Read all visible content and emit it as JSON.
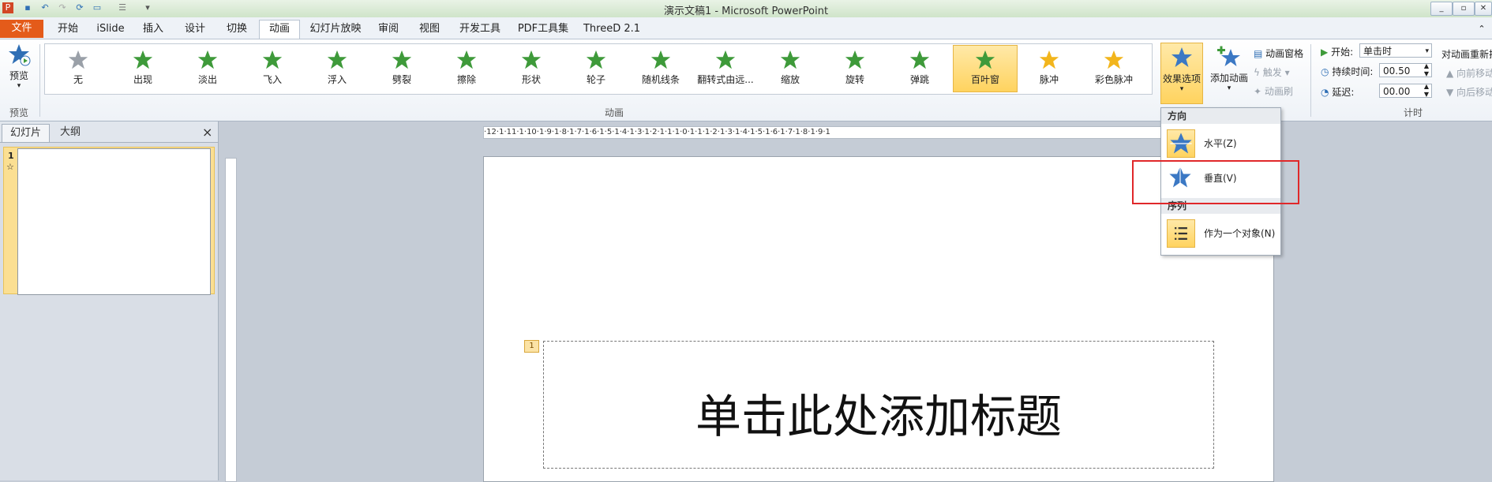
{
  "window": {
    "title": "演示文稿1 - Microsoft PowerPoint"
  },
  "tabs": [
    "文件",
    "开始",
    "iSlide",
    "插入",
    "设计",
    "切换",
    "动画",
    "幻灯片放映",
    "审阅",
    "视图",
    "开发工具",
    "PDF工具集",
    "ThreeD 2.1"
  ],
  "ribbon": {
    "preview_label": "预览",
    "preview_group": "预览",
    "animation_group": "动画",
    "timing_group": "计时",
    "animations": [
      "无",
      "出现",
      "淡出",
      "飞入",
      "浮入",
      "劈裂",
      "擦除",
      "形状",
      "轮子",
      "随机线条",
      "翻转式由远...",
      "缩放",
      "旋转",
      "弹跳",
      "百叶窗",
      "脉冲",
      "彩色脉冲"
    ],
    "selected_animation": "百叶窗",
    "effect_options": "效果选项",
    "add_animation": "添加动画",
    "animation_pane": "动画窗格",
    "trigger": "触发",
    "animation_painter": "动画刷",
    "start_label": "开始:",
    "start_value": "单击时",
    "duration_label": "持续时间:",
    "duration_value": "00.50",
    "delay_label": "延迟:",
    "delay_value": "00.00",
    "reorder_label": "对动画重新排",
    "move_earlier": "向前移动",
    "move_later": "向后移动"
  },
  "left_pane": {
    "tab_slides": "幻灯片",
    "tab_outline": "大纲",
    "close": "×",
    "slide_number": "1",
    "slide_star": "☆"
  },
  "slide": {
    "title_placeholder": "单击此处添加标题",
    "anim_tag": "1"
  },
  "ruler_text": "·12·1·11·1·10·1·9·1·8·1·7·1·6·1·5·1·4·1·3·1·2·1·1·1·0·1·1·1·2·1·3·1·4·1·5·1·6·1·7·1·8·1·9·1",
  "dropdown": {
    "direction_header": "方向",
    "horizontal": "水平(Z)",
    "vertical": "垂直(V)",
    "sequence_header": "序列",
    "as_one_object": "作为一个对象(N)"
  },
  "colors": {
    "file_tab": "#e45b1a",
    "selected": "#ffd35f",
    "highlight_box": "#e0282a",
    "star_green": "#3e9a3a"
  }
}
